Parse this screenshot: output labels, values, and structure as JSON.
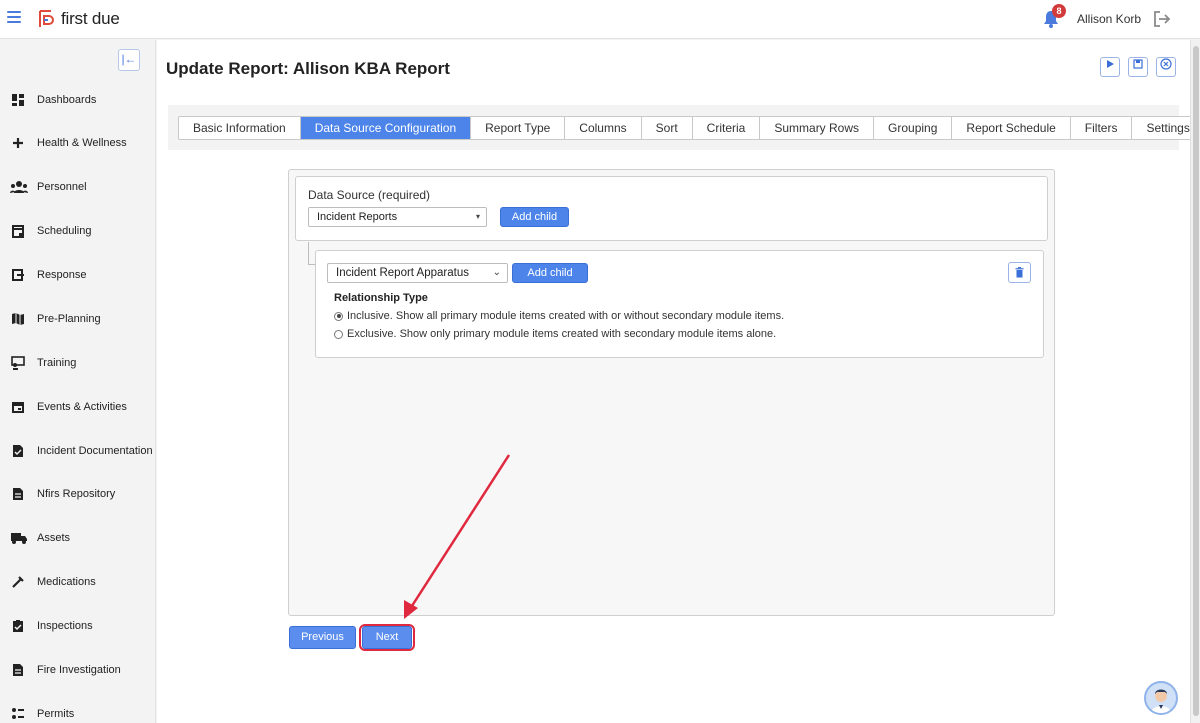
{
  "app": {
    "name": "first due",
    "brand_color": "#4a7bdc"
  },
  "topbar": {
    "notification_count": "8",
    "user_name": "Allison Korb"
  },
  "sidebar": {
    "items": [
      {
        "label": "Dashboards",
        "icon": "grid-icon"
      },
      {
        "label": "Health & Wellness",
        "icon": "plus-icon"
      },
      {
        "label": "Personnel",
        "icon": "people-icon"
      },
      {
        "label": "Scheduling",
        "icon": "calendar-icon"
      },
      {
        "label": "Response",
        "icon": "response-icon"
      },
      {
        "label": "Pre-Planning",
        "icon": "map-icon"
      },
      {
        "label": "Training",
        "icon": "training-icon"
      },
      {
        "label": "Events & Activities",
        "icon": "calendar-event-icon"
      },
      {
        "label": "Incident Documentation",
        "icon": "document-icon"
      },
      {
        "label": "Nfirs Repository",
        "icon": "document-icon"
      },
      {
        "label": "Assets",
        "icon": "truck-icon"
      },
      {
        "label": "Medications",
        "icon": "syringe-icon"
      },
      {
        "label": "Inspections",
        "icon": "clipboard-check-icon"
      },
      {
        "label": "Fire Investigation",
        "icon": "document-icon"
      },
      {
        "label": "Permits",
        "icon": "permits-icon"
      }
    ]
  },
  "main": {
    "title": "Update Report: Allison KBA Report",
    "tabs": [
      {
        "label": "Basic Information"
      },
      {
        "label": "Data Source Configuration",
        "active": true
      },
      {
        "label": "Report Type"
      },
      {
        "label": "Columns"
      },
      {
        "label": "Sort"
      },
      {
        "label": "Criteria"
      },
      {
        "label": "Summary Rows"
      },
      {
        "label": "Grouping"
      },
      {
        "label": "Report Schedule"
      },
      {
        "label": "Filters"
      },
      {
        "label": "Settings"
      }
    ],
    "data_source": {
      "label": "Data Source (required)",
      "selected": "Incident Reports",
      "add_child_label": "Add child"
    },
    "child": {
      "selected": "Incident Report Apparatus",
      "add_child_label": "Add child",
      "relationship_title": "Relationship Type",
      "options": [
        {
          "label": "Inclusive. Show all primary module items created with or without secondary module items.",
          "checked": true
        },
        {
          "label": "Exclusive. Show only primary module items created with secondary module items alone.",
          "checked": false
        }
      ]
    },
    "previous_label": "Previous",
    "next_label": "Next"
  },
  "colors": {
    "accent": "#4d84ea",
    "highlight": "#e0283f"
  }
}
